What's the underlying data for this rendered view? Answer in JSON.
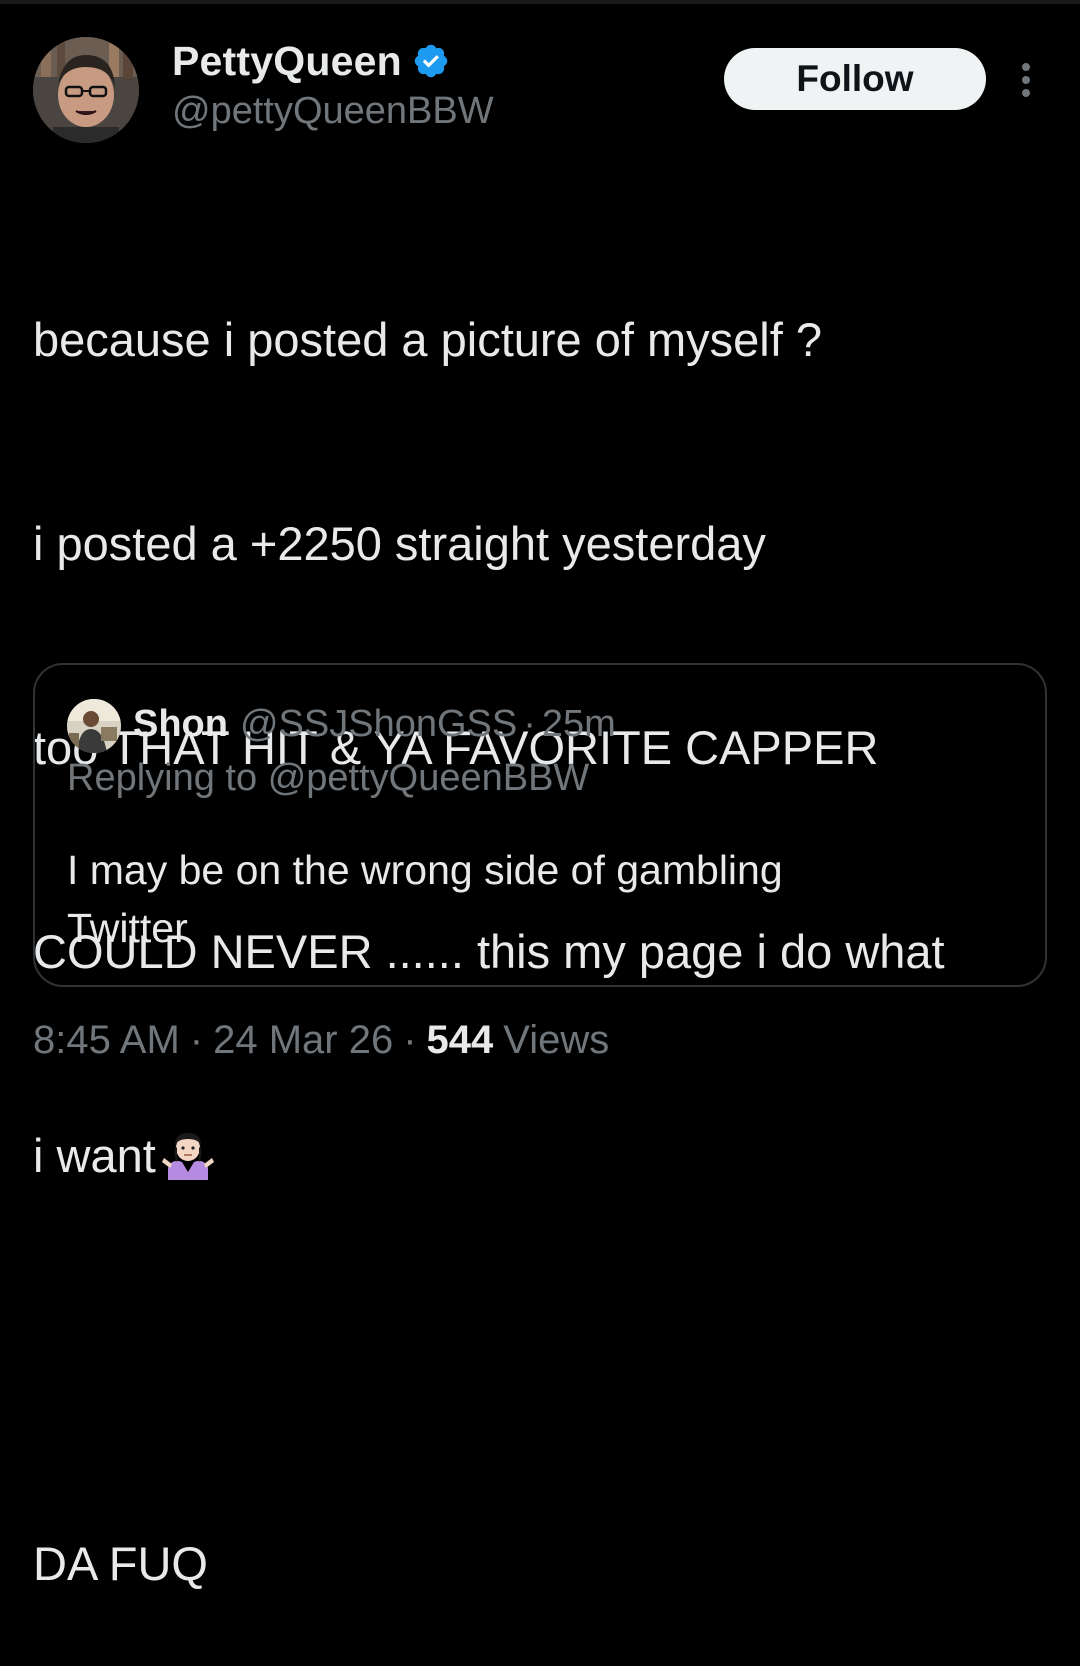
{
  "author": {
    "display_name": "PettyQueen",
    "handle": "@pettyQueenBBW",
    "verified": true,
    "avatar_icon": "profile-photo"
  },
  "actions": {
    "follow_label": "Follow",
    "more_icon": "more-vertical-icon"
  },
  "tweet": {
    "lines": [
      "because i posted a picture of myself ?",
      "i posted a +2250 straight yesterday",
      "too THAT HIT & YA FAVORITE CAPPER",
      "COULD NEVER ...... this my page i do what",
      "i want",
      "",
      "DA FUQ"
    ],
    "emoji": "person-shrugging-emoji"
  },
  "quoted_tweet": {
    "display_name": "Shon",
    "handle": "@SSJShonGSS",
    "separator": "·",
    "time": "25m",
    "replying_prefix": "Replying to",
    "replying_to": "@pettyQueenBBW",
    "text_lines": [
      "I may be on the wrong side of gambling",
      "Twitter"
    ]
  },
  "meta": {
    "time": "8:45 AM",
    "separator": "·",
    "date": "24 Mar 26",
    "views_count": "544",
    "views_label": "Views"
  },
  "colors": {
    "background": "#000000",
    "text_primary": "#e7e9ea",
    "text_secondary": "#71767b",
    "border": "#2f3336",
    "verified_blue": "#1d9bf0",
    "follow_bg": "#eff3f4"
  }
}
